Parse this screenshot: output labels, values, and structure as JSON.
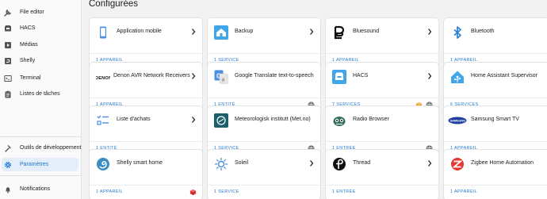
{
  "colors": {
    "accent": "#1f78d1",
    "sidebar_bg": "#fafafa",
    "active_bg": "#e3eefa",
    "page_bg": "#f2f2f2"
  },
  "sidebar": {
    "items": [
      {
        "label": "File editor",
        "icon": "wrench-icon"
      },
      {
        "label": "HACS",
        "icon": "hacs-icon"
      },
      {
        "label": "Médias",
        "icon": "media-icon"
      },
      {
        "label": "Shelly",
        "icon": "shelly-icon"
      },
      {
        "label": "Terminal",
        "icon": "terminal-icon"
      },
      {
        "label": "Listes de tâches",
        "icon": "clipboard-list-icon"
      },
      {
        "label": "Outils de développement",
        "icon": "hammer-icon"
      },
      {
        "label": "Paramètres",
        "icon": "gear-icon",
        "active": true
      },
      {
        "label": "Notifications",
        "icon": "bell-icon"
      }
    ]
  },
  "main": {
    "title": "Configurées",
    "cards": [
      {
        "name": "Application mobile",
        "link": "1 APPAREIL",
        "icon": "phone-icon"
      },
      {
        "name": "Backup",
        "link": "1 SERVICE",
        "icon": "backup-icon"
      },
      {
        "name": "Bluesound",
        "link": "1 APPAREIL",
        "icon": "bluesound-icon"
      },
      {
        "name": "Bluetooth",
        "link": "1 APPAREIL",
        "icon": "bluetooth-icon"
      },
      {
        "name": "Denon AVR Network Receivers",
        "link": "1 APPAREIL",
        "icon": "denon-logo"
      },
      {
        "name": "Google Translate text-to-speech",
        "link": "1 ENTITÉ",
        "icon": "google-translate-icon",
        "badges": [
          "globe-icon"
        ]
      },
      {
        "name": "HACS",
        "link": "7 SERVICES",
        "icon": "hacs-icon",
        "badges": [
          "custom-integration-icon",
          "globe-icon"
        ]
      },
      {
        "name": "Home Assistant Supervisor",
        "link": "6 SERVICES",
        "icon": "home-assistant-icon"
      },
      {
        "name": "Liste d'achats",
        "link": "1 ENTITÉ",
        "icon": "shopping-list-icon"
      },
      {
        "name": "Meteorologisk institutt (Met.no)",
        "link": "1 SERVICE",
        "icon": "met-no-icon",
        "badges": [
          "globe-icon"
        ]
      },
      {
        "name": "Radio Browser",
        "link": "1 ENTRÉE",
        "icon": "radio-browser-icon",
        "badges": [
          "globe-icon"
        ]
      },
      {
        "name": "Samsung Smart TV",
        "link": "1 APPAREIL",
        "icon": "samsung-logo"
      },
      {
        "name": "Shelly smart home",
        "link": "1 APPAREIL",
        "icon": "shelly-icon",
        "badges": [
          "custom-integration-icon"
        ]
      },
      {
        "name": "Soleil",
        "link": "1 SERVICE",
        "icon": "sun-icon"
      },
      {
        "name": "Thread",
        "link": "1 ENTRÉE",
        "icon": "thread-icon"
      },
      {
        "name": "Zigbee Home Automation",
        "link": "1 APPAREIL",
        "icon": "zigbee-icon"
      }
    ]
  }
}
